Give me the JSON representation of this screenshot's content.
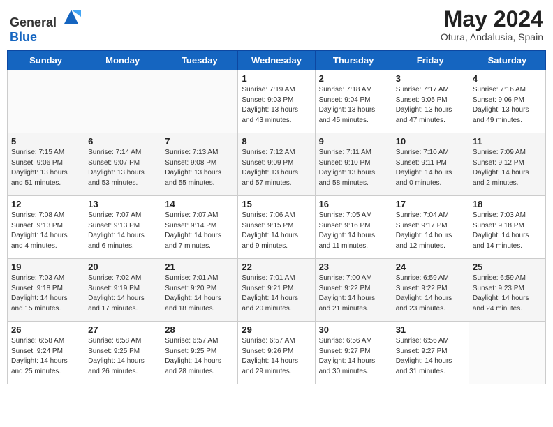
{
  "logo": {
    "general": "General",
    "blue": "Blue"
  },
  "header": {
    "month_year": "May 2024",
    "location": "Otura, Andalusia, Spain"
  },
  "weekdays": [
    "Sunday",
    "Monday",
    "Tuesday",
    "Wednesday",
    "Thursday",
    "Friday",
    "Saturday"
  ],
  "weeks": [
    [
      {
        "day": "",
        "sunrise": "",
        "sunset": "",
        "daylight": ""
      },
      {
        "day": "",
        "sunrise": "",
        "sunset": "",
        "daylight": ""
      },
      {
        "day": "",
        "sunrise": "",
        "sunset": "",
        "daylight": ""
      },
      {
        "day": "1",
        "sunrise": "Sunrise: 7:19 AM",
        "sunset": "Sunset: 9:03 PM",
        "daylight": "Daylight: 13 hours and 43 minutes."
      },
      {
        "day": "2",
        "sunrise": "Sunrise: 7:18 AM",
        "sunset": "Sunset: 9:04 PM",
        "daylight": "Daylight: 13 hours and 45 minutes."
      },
      {
        "day": "3",
        "sunrise": "Sunrise: 7:17 AM",
        "sunset": "Sunset: 9:05 PM",
        "daylight": "Daylight: 13 hours and 47 minutes."
      },
      {
        "day": "4",
        "sunrise": "Sunrise: 7:16 AM",
        "sunset": "Sunset: 9:06 PM",
        "daylight": "Daylight: 13 hours and 49 minutes."
      }
    ],
    [
      {
        "day": "5",
        "sunrise": "Sunrise: 7:15 AM",
        "sunset": "Sunset: 9:06 PM",
        "daylight": "Daylight: 13 hours and 51 minutes."
      },
      {
        "day": "6",
        "sunrise": "Sunrise: 7:14 AM",
        "sunset": "Sunset: 9:07 PM",
        "daylight": "Daylight: 13 hours and 53 minutes."
      },
      {
        "day": "7",
        "sunrise": "Sunrise: 7:13 AM",
        "sunset": "Sunset: 9:08 PM",
        "daylight": "Daylight: 13 hours and 55 minutes."
      },
      {
        "day": "8",
        "sunrise": "Sunrise: 7:12 AM",
        "sunset": "Sunset: 9:09 PM",
        "daylight": "Daylight: 13 hours and 57 minutes."
      },
      {
        "day": "9",
        "sunrise": "Sunrise: 7:11 AM",
        "sunset": "Sunset: 9:10 PM",
        "daylight": "Daylight: 13 hours and 58 minutes."
      },
      {
        "day": "10",
        "sunrise": "Sunrise: 7:10 AM",
        "sunset": "Sunset: 9:11 PM",
        "daylight": "Daylight: 14 hours and 0 minutes."
      },
      {
        "day": "11",
        "sunrise": "Sunrise: 7:09 AM",
        "sunset": "Sunset: 9:12 PM",
        "daylight": "Daylight: 14 hours and 2 minutes."
      }
    ],
    [
      {
        "day": "12",
        "sunrise": "Sunrise: 7:08 AM",
        "sunset": "Sunset: 9:13 PM",
        "daylight": "Daylight: 14 hours and 4 minutes."
      },
      {
        "day": "13",
        "sunrise": "Sunrise: 7:07 AM",
        "sunset": "Sunset: 9:13 PM",
        "daylight": "Daylight: 14 hours and 6 minutes."
      },
      {
        "day": "14",
        "sunrise": "Sunrise: 7:07 AM",
        "sunset": "Sunset: 9:14 PM",
        "daylight": "Daylight: 14 hours and 7 minutes."
      },
      {
        "day": "15",
        "sunrise": "Sunrise: 7:06 AM",
        "sunset": "Sunset: 9:15 PM",
        "daylight": "Daylight: 14 hours and 9 minutes."
      },
      {
        "day": "16",
        "sunrise": "Sunrise: 7:05 AM",
        "sunset": "Sunset: 9:16 PM",
        "daylight": "Daylight: 14 hours and 11 minutes."
      },
      {
        "day": "17",
        "sunrise": "Sunrise: 7:04 AM",
        "sunset": "Sunset: 9:17 PM",
        "daylight": "Daylight: 14 hours and 12 minutes."
      },
      {
        "day": "18",
        "sunrise": "Sunrise: 7:03 AM",
        "sunset": "Sunset: 9:18 PM",
        "daylight": "Daylight: 14 hours and 14 minutes."
      }
    ],
    [
      {
        "day": "19",
        "sunrise": "Sunrise: 7:03 AM",
        "sunset": "Sunset: 9:18 PM",
        "daylight": "Daylight: 14 hours and 15 minutes."
      },
      {
        "day": "20",
        "sunrise": "Sunrise: 7:02 AM",
        "sunset": "Sunset: 9:19 PM",
        "daylight": "Daylight: 14 hours and 17 minutes."
      },
      {
        "day": "21",
        "sunrise": "Sunrise: 7:01 AM",
        "sunset": "Sunset: 9:20 PM",
        "daylight": "Daylight: 14 hours and 18 minutes."
      },
      {
        "day": "22",
        "sunrise": "Sunrise: 7:01 AM",
        "sunset": "Sunset: 9:21 PM",
        "daylight": "Daylight: 14 hours and 20 minutes."
      },
      {
        "day": "23",
        "sunrise": "Sunrise: 7:00 AM",
        "sunset": "Sunset: 9:22 PM",
        "daylight": "Daylight: 14 hours and 21 minutes."
      },
      {
        "day": "24",
        "sunrise": "Sunrise: 6:59 AM",
        "sunset": "Sunset: 9:22 PM",
        "daylight": "Daylight: 14 hours and 23 minutes."
      },
      {
        "day": "25",
        "sunrise": "Sunrise: 6:59 AM",
        "sunset": "Sunset: 9:23 PM",
        "daylight": "Daylight: 14 hours and 24 minutes."
      }
    ],
    [
      {
        "day": "26",
        "sunrise": "Sunrise: 6:58 AM",
        "sunset": "Sunset: 9:24 PM",
        "daylight": "Daylight: 14 hours and 25 minutes."
      },
      {
        "day": "27",
        "sunrise": "Sunrise: 6:58 AM",
        "sunset": "Sunset: 9:25 PM",
        "daylight": "Daylight: 14 hours and 26 minutes."
      },
      {
        "day": "28",
        "sunrise": "Sunrise: 6:57 AM",
        "sunset": "Sunset: 9:25 PM",
        "daylight": "Daylight: 14 hours and 28 minutes."
      },
      {
        "day": "29",
        "sunrise": "Sunrise: 6:57 AM",
        "sunset": "Sunset: 9:26 PM",
        "daylight": "Daylight: 14 hours and 29 minutes."
      },
      {
        "day": "30",
        "sunrise": "Sunrise: 6:56 AM",
        "sunset": "Sunset: 9:27 PM",
        "daylight": "Daylight: 14 hours and 30 minutes."
      },
      {
        "day": "31",
        "sunrise": "Sunrise: 6:56 AM",
        "sunset": "Sunset: 9:27 PM",
        "daylight": "Daylight: 14 hours and 31 minutes."
      },
      {
        "day": "",
        "sunrise": "",
        "sunset": "",
        "daylight": ""
      }
    ]
  ]
}
